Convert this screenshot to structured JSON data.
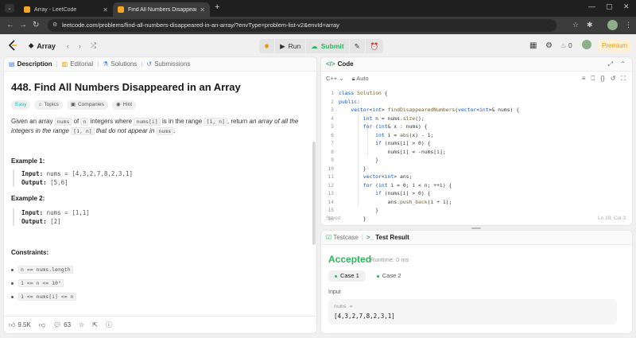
{
  "browser": {
    "tabs": [
      {
        "title": "Array - LeetCode",
        "active": false
      },
      {
        "title": "Find All Numbers Disappeared",
        "active": true
      }
    ],
    "url": "leetcode.com/problems/find-all-numbers-disappeared-in-an-array/?envType=problem-list-v2&envId=array"
  },
  "header": {
    "problem_list": "Array",
    "run_label": "Run",
    "submit_label": "Submit",
    "streak_count": "0",
    "premium_label": "Premium"
  },
  "left": {
    "tabs": [
      "Description",
      "Editorial",
      "Solutions",
      "Submissions"
    ],
    "title": "448. Find All Numbers Disappeared in an Array",
    "chips": [
      "Easy",
      "Topics",
      "Companies",
      "Hint"
    ],
    "desc": {
      "p1": "Given an array ",
      "c1": "nums",
      "p2": " of ",
      "c2": "n",
      "p3": " integers where ",
      "c3": "nums[i]",
      "p4": " is in the range ",
      "c4": "[1, n]",
      "p5": ", return ",
      "e1": "an array of all the integers in the range ",
      "c5": "[1, n]",
      "e2": " that do not appear in ",
      "c6": "nums",
      "p6": "."
    },
    "examples": [
      {
        "heading": "Example 1:",
        "input_label": "Input:",
        "input": "nums = [4,3,2,7,8,2,3,1]",
        "output_label": "Output:",
        "output": "[5,6]"
      },
      {
        "heading": "Example 2:",
        "input_label": "Input:",
        "input": "nums = [1,1]",
        "output_label": "Output:",
        "output": "[2]"
      }
    ],
    "constraints_heading": "Constraints:",
    "constraints": [
      "n == nums.length",
      "1 <= n <= 10⁵",
      "1 <= nums[i] <= n"
    ],
    "footer": {
      "likes": "9.5K",
      "comments": "63"
    }
  },
  "code": {
    "title": "Code",
    "language": "C++",
    "mode": "Auto",
    "lines": [
      "class Solution {",
      "public:",
      "    vector<int> findDisappearedNumbers(vector<int>& nums) {",
      "        int n = nums.size();",
      "        for (int& x : nums) {",
      "            int i = abs(x) - 1;",
      "            if (nums[i] > 0) {",
      "                nums[i] = -nums[i];",
      "            }",
      "        }",
      "        vector<int> ans;",
      "        for (int i = 0; i < n; ++i) {",
      "            if (nums[i] > 0) {",
      "                ans.push_back(i + 1);",
      "            }",
      "        }"
    ],
    "status": "Saved",
    "position": "Ln 19, Col 3"
  },
  "result": {
    "tabs": [
      "Testcase",
      "Test Result"
    ],
    "verdict": "Accepted",
    "runtime": "Runtime: 0 ms",
    "cases": [
      "Case 1",
      "Case 2"
    ],
    "input_label": "Input",
    "input_name": "nums =",
    "input_value": "[4,3,2,7,8,2,3,1]"
  },
  "colors": {
    "accepted": "#2db55d",
    "easy": "#1cb8b8",
    "premium": "#e59b00"
  }
}
